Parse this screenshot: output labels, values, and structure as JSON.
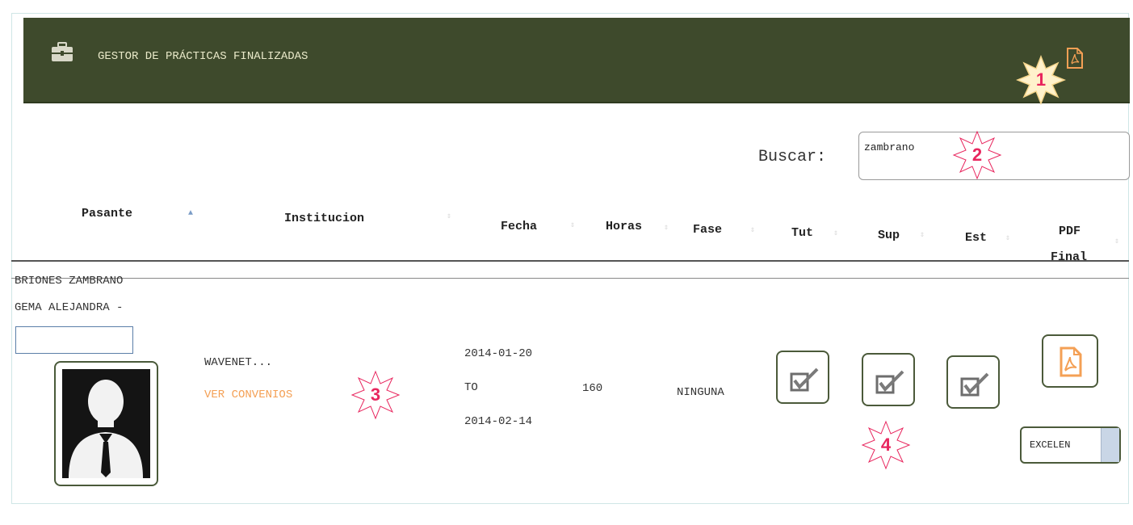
{
  "header": {
    "title": "GESTOR DE PRÁCTICAS FINALIZADAS",
    "briefcase_icon": "briefcase-icon",
    "export_icon": "pdf-file-icon"
  },
  "search": {
    "label": "Buscar:",
    "value": "zambrano"
  },
  "columns": [
    "Pasante",
    "Institucion",
    "Fecha",
    "Horas",
    "Fase",
    "Tut",
    "Sup",
    "Est",
    "PDF",
    "Final"
  ],
  "row": {
    "name_line1": "BRIONES ZAMBRANO",
    "name_line2": "GEMA ALEJANDRA -",
    "institution": "WAVENET...",
    "agreements_link": "VER CONVENIOS",
    "date_start": "2014-01-20",
    "date_sep": "TO",
    "date_end": "2014-02-14",
    "hours": "160",
    "phase": "NINGUNA",
    "tut_checked": true,
    "sup_checked": true,
    "est_checked": true,
    "rating": "EXCELEN"
  },
  "callouts": [
    "1",
    "2",
    "3",
    "4"
  ],
  "colors": {
    "header_bg": "#3e4a2c",
    "accent_orange": "#f4a055",
    "callout_pink": "#e8265e"
  }
}
